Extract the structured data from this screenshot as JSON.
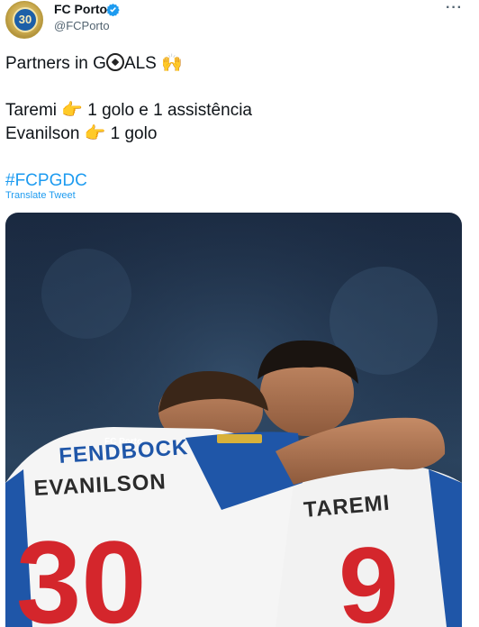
{
  "tweet": {
    "display_name": "FC Porto",
    "handle": "@FCPorto",
    "avatar_text": "30",
    "more_label": "···",
    "text_line1_a": "Partners in G",
    "text_line1_b": "ALS",
    "text_line1_emoji": "🙌",
    "text_line2_a": "Taremi",
    "text_line2_emoji": "👉",
    "text_line2_b": "1 golo e 1 assistência",
    "text_line3_a": "Evanilson",
    "text_line3_emoji": "👉",
    "text_line3_b": "1 golo",
    "hashtag": "#FCPGDC",
    "translate_label": "Translate Tweet"
  },
  "media": {
    "left_player_name": "EVANILSON",
    "left_player_number": "30",
    "right_player_name": "TAREMI",
    "right_player_number": "9",
    "sponsor_text": "FENDBOCK",
    "kit_brand": "FC Porto"
  },
  "colors": {
    "accent": "#1d9bf0",
    "verified": "#1d9bf0",
    "jersey_blue": "#1f56a8",
    "jersey_number": "#d4262c"
  }
}
